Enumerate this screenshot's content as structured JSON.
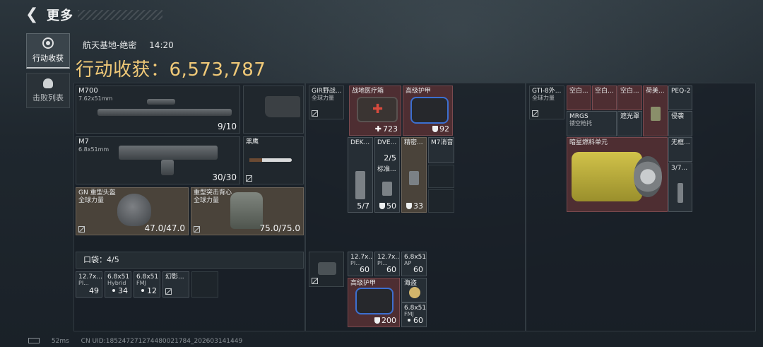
{
  "header": {
    "title": "更多"
  },
  "side_tabs": [
    {
      "label": "行动收获"
    },
    {
      "label": "击败列表"
    }
  ],
  "info": {
    "map": "航天基地-绝密",
    "time": "14:20",
    "haul_label": "行动收获：",
    "haul_value": "6,573,787"
  },
  "weapons": {
    "primary1": {
      "name": "M700",
      "caliber": "7.62x51mm",
      "ammo": "9/10"
    },
    "primary2": {
      "name": "M7",
      "caliber": "6.8x51mm",
      "ammo": "30/30"
    },
    "melee": {
      "name": "黑鹰"
    }
  },
  "armor": {
    "helmet": {
      "name": "GN 重型头盔",
      "faction": "全球力量",
      "durability": "47.0/47.0"
    },
    "vest": {
      "name": "重型突击背心",
      "faction": "全球力量",
      "durability": "75.0/75.0"
    }
  },
  "pouch": {
    "label": "口袋：4/5",
    "items": [
      {
        "name": "12.7x...",
        "sub": "PI...",
        "count": "49"
      },
      {
        "name": "6.8x51",
        "sub": "Hybrid",
        "count": "34"
      },
      {
        "name": "6.8x51",
        "sub": "FMJ",
        "count": "12"
      },
      {
        "name": "幻影...",
        "count": ""
      }
    ]
  },
  "chest_rig": {
    "header": {
      "name": "GIR野战...",
      "sub": "全球力量"
    },
    "items": {
      "medkit": {
        "name": "战地医疗箱",
        "count": "723"
      },
      "armor": {
        "name": "高级护甲",
        "count": "92"
      },
      "dek": {
        "name": "DEK...",
        "count": "5/7"
      },
      "dve": {
        "name": "DVE...",
        "count": "2/5"
      },
      "std": {
        "name": "标准...",
        "count": "50"
      },
      "precise": {
        "name": "精密...",
        "count": "33"
      },
      "m7sup": {
        "name": "M7消音"
      }
    }
  },
  "backpack": {
    "items": [
      {
        "name": "12.7x...",
        "sub": "PI...",
        "count": "60"
      },
      {
        "name": "12.7x...",
        "sub": "PI...",
        "count": "60"
      },
      {
        "name": "6.8x51",
        "sub": "AP",
        "count": "60"
      },
      {
        "name": "高级护甲",
        "count": "200"
      },
      {
        "name": "海盗",
        "count": ""
      },
      {
        "name": "6.8x51",
        "sub": "FMJ",
        "count": "60"
      }
    ]
  },
  "safe_box": {
    "header": {
      "name": "GTI-8外...",
      "sub": "全球力量"
    },
    "items": {
      "blank1": {
        "name": "空白..."
      },
      "blank2": {
        "name": "空白..."
      },
      "blank3": {
        "name": "空白..."
      },
      "dutch": {
        "name": "荷美..."
      },
      "peq": {
        "name": "PEQ-2"
      },
      "mrgs": {
        "name": "MRGS",
        "sub": "镂空枪托"
      },
      "shade": {
        "name": "遮光罩"
      },
      "watch": {
        "name": "侵袭"
      },
      "fuel": {
        "name": "暗星燃料单元"
      },
      "nobox": {
        "name": "无框..."
      },
      "scope": {
        "name": "3/7..."
      }
    }
  },
  "footer": {
    "ping": "52ms",
    "uid": "CN UID:1852472712744800217​84_202603141449"
  }
}
